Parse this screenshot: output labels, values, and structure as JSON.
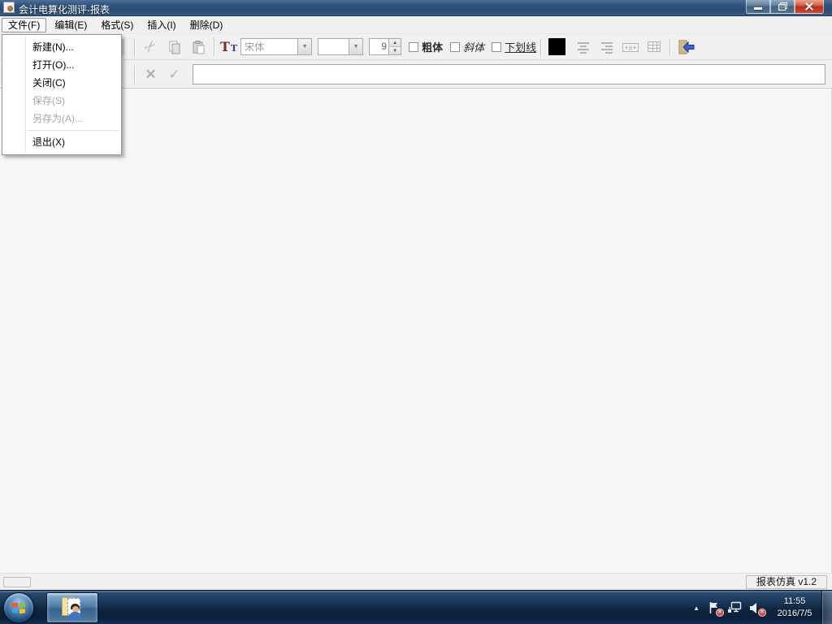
{
  "window": {
    "title": "会计电算化测评-报表"
  },
  "menu_bar": {
    "items": [
      {
        "label": "文件(F)",
        "active": true
      },
      {
        "label": "编辑(E)",
        "active": false
      },
      {
        "label": "格式(S)",
        "active": false
      },
      {
        "label": "插入(I)",
        "active": false
      },
      {
        "label": "删除(D)",
        "active": false
      }
    ]
  },
  "file_menu": {
    "items": [
      {
        "label": "新建(N)...",
        "enabled": true
      },
      {
        "label": "打开(O)...",
        "enabled": true
      },
      {
        "label": "关闭(C)",
        "enabled": true
      },
      {
        "label": "保存(S)",
        "enabled": false
      },
      {
        "label": "另存为(A)...",
        "enabled": false
      },
      {
        "label": "退出(X)",
        "enabled": true
      }
    ]
  },
  "toolbar": {
    "font_icon_large": "T",
    "font_icon_small": "T",
    "font_name": "宋体",
    "font_size_selected": "",
    "size_spinner_value": "9",
    "bold_label": "粗体",
    "italic_label": "斜体",
    "underline_label": "下划线",
    "color_swatch": "#000000"
  },
  "formula_bar": {
    "value": ""
  },
  "status_bar": {
    "version": "报表仿真 v1.2"
  },
  "taskbar": {
    "clock_time": "11:55",
    "clock_date": "2016/7/5"
  },
  "icons": {
    "cut": "✂",
    "cancel": "×",
    "confirm": "✓",
    "dropdown": "▼",
    "spin_up": "▲",
    "spin_down": "▼",
    "tray_expand": "▲"
  }
}
